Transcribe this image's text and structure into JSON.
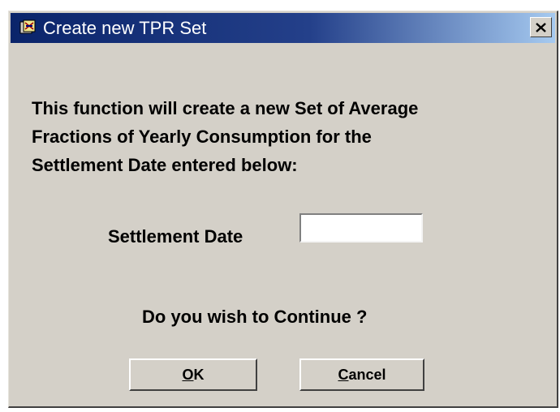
{
  "window": {
    "title": "Create new TPR Set",
    "icon": "app-icon",
    "close_icon": "close-icon"
  },
  "message": {
    "lines": [
      "This function will create a new Set of Average",
      "Fractions of Yearly Consumption for the",
      "Settlement Date entered below:"
    ]
  },
  "settlement_date": {
    "label": "Settlement Date",
    "value": ""
  },
  "prompt": {
    "question": "Do you wish to Continue ?"
  },
  "buttons": {
    "ok": {
      "mnemonic": "O",
      "rest": "K"
    },
    "cancel": {
      "mnemonic": "C",
      "rest": "ancel"
    }
  },
  "colors": {
    "titlebar_start": "#0a246a",
    "titlebar_end": "#a6caf0",
    "face": "#d4d0c8"
  }
}
